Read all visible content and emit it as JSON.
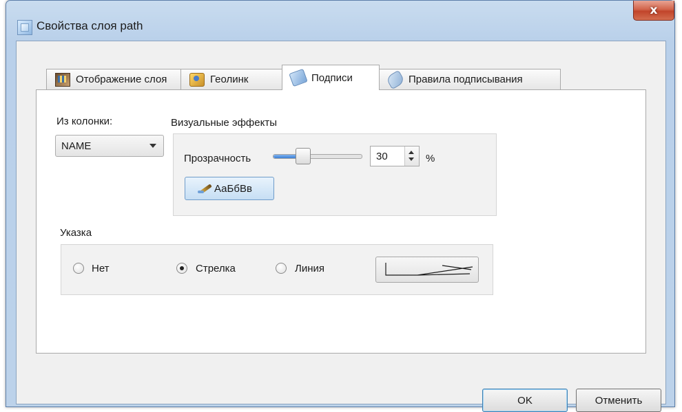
{
  "window": {
    "title": "Свойства слоя path",
    "close_label": "x"
  },
  "tabs": [
    {
      "label": "Отображение слоя",
      "icon": "layer-display-icon",
      "active": false
    },
    {
      "label": "Геолинк",
      "icon": "geolink-icon",
      "active": false
    },
    {
      "label": "Подписи",
      "icon": "labels-icon",
      "active": true
    },
    {
      "label": "Правила подписывания",
      "icon": "labeling-rules-icon",
      "active": false
    }
  ],
  "column": {
    "label": "Из колонки:",
    "selected": "NAME"
  },
  "visual_effects": {
    "label": "Визуальные эффекты",
    "transparency_label": "Прозрачность",
    "transparency_value": "30",
    "transparency_fraction": 0.3,
    "unit": "%",
    "font_sample": "АаБбВв"
  },
  "pointer": {
    "label": "Указка",
    "options": [
      {
        "label": "Нет",
        "checked": false
      },
      {
        "label": "Стрелка",
        "checked": true
      },
      {
        "label": "Линия",
        "checked": false
      }
    ]
  },
  "buttons": {
    "ok": "OK",
    "cancel": "Отменить"
  }
}
